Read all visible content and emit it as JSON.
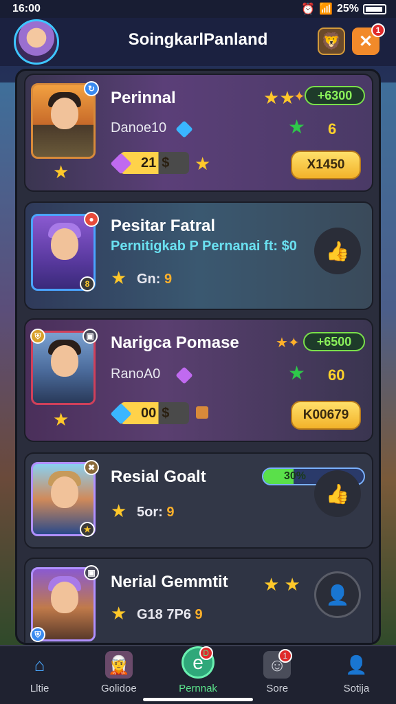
{
  "status": {
    "time": "16:00",
    "battery": "25%"
  },
  "header": {
    "title": "SoingkarlPanland",
    "close_badge": "1"
  },
  "cards": [
    {
      "name": "Perinnal",
      "subtitle": "Danoe10",
      "price": "+6300",
      "count": "6",
      "resource_value": "21",
      "action_label": "X1450",
      "resource_icon": "purple-gem"
    },
    {
      "name": "Pesitar Fatral",
      "description": "Pernitigkab P Pernanai ft: $0",
      "stat_label": "Gn:",
      "stat_value": "9",
      "badge": "8"
    },
    {
      "name": "Narigca Pomase",
      "subtitle": "RanoA0",
      "price": "+6500",
      "count": "60",
      "resource_value": "00",
      "action_label": "K00679"
    },
    {
      "name": "Resial Goalt",
      "stat_label": "5or:",
      "stat_value": "9",
      "progress_label": "30%",
      "progress": 0.3
    },
    {
      "name": "Nerial Gemmtit",
      "stat_label": "G18 7P6",
      "stat_value": "9"
    }
  ],
  "tabs": [
    {
      "label": "Lltie",
      "icon": "home-icon"
    },
    {
      "label": "Golidoe",
      "icon": "character-icon"
    },
    {
      "label": "Pernnak",
      "icon": "center-icon",
      "badge": "D"
    },
    {
      "label": "Sore",
      "icon": "chat-icon",
      "badge": "1"
    },
    {
      "label": "Sotija",
      "icon": "profile-icon"
    }
  ]
}
